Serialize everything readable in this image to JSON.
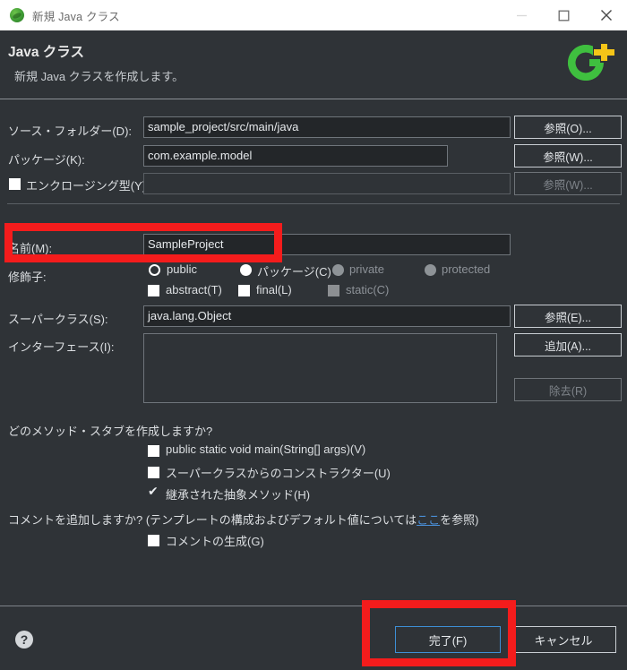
{
  "window": {
    "title": "新規 Java クラス",
    "icon": "eclipse-leaf-icon",
    "controls": {
      "minimize": "minimize-icon",
      "maximize": "maximize-icon",
      "close": "close-icon"
    }
  },
  "header": {
    "title": "Java クラス",
    "subtitle": "新規 Java クラスを作成します。",
    "logo": "new-java-class-icon"
  },
  "form": {
    "source_folder": {
      "label": "ソース・フォルダー(D):",
      "value": "sample_project/src/main/java",
      "browse": "参照(O)..."
    },
    "package": {
      "label": "パッケージ(K):",
      "value": "com.example.model",
      "browse": "参照(W)..."
    },
    "enclosing_type": {
      "label": "エンクロージング型(Y):",
      "value": "",
      "browse": "参照(W)...",
      "checked": false
    },
    "name": {
      "label": "名前(M):",
      "value": "SampleProject"
    },
    "modifiers": {
      "label": "修飾子:",
      "radios": [
        {
          "label": "public",
          "selected": true,
          "enabled": true
        },
        {
          "label": "パッケージ(C)",
          "selected": false,
          "enabled": true
        },
        {
          "label": "private",
          "selected": false,
          "enabled": false
        },
        {
          "label": "protected",
          "selected": false,
          "enabled": false
        }
      ],
      "checks": [
        {
          "label": "abstract(T)",
          "checked": false,
          "enabled": true
        },
        {
          "label": "final(L)",
          "checked": false,
          "enabled": true
        },
        {
          "label": "static(C)",
          "checked": false,
          "enabled": false
        }
      ]
    },
    "superclass": {
      "label": "スーパークラス(S):",
      "value": "java.lang.Object",
      "browse": "参照(E)..."
    },
    "interfaces": {
      "label": "インターフェース(I):",
      "items": [],
      "add": "追加(A)...",
      "remove": "除去(R)"
    },
    "method_stubs": {
      "question": "どのメソッド・スタブを作成しますか?",
      "options": [
        {
          "label": "public static void main(String[] args)(V)",
          "checked": false
        },
        {
          "label": "スーパークラスからのコンストラクター(U)",
          "checked": false
        },
        {
          "label": "継承された抽象メソッド(H)",
          "checked": true
        }
      ]
    },
    "comments": {
      "question_prefix": "コメントを追加しますか? (テンプレートの構成およびデフォルト値については",
      "link": "ここ",
      "question_suffix": "を参照)",
      "option": {
        "label": "コメントの生成(G)",
        "checked": false
      }
    }
  },
  "footer": {
    "help": "help-icon",
    "finish": "完了(F)",
    "cancel": "キャンセル"
  },
  "annotations": {
    "highlight_color": "#f41c1c",
    "boxes": [
      {
        "name": "name-field-highlight"
      },
      {
        "name": "finish-button-highlight"
      }
    ]
  }
}
